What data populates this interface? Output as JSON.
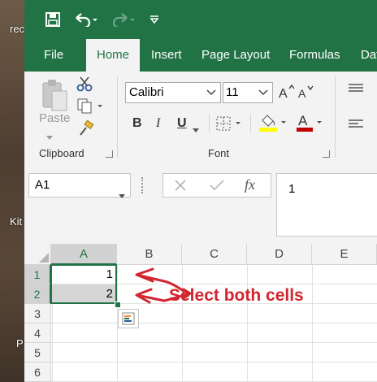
{
  "desktop": {
    "labels": [
      "rec",
      "Kit",
      "P"
    ]
  },
  "qat": {
    "save_icon": "save-icon",
    "undo_icon": "undo-icon",
    "redo_icon": "redo-icon",
    "customize_icon": "customize-qat-icon"
  },
  "tabs": [
    "File",
    "Home",
    "Insert",
    "Page Layout",
    "Formulas",
    "Dat"
  ],
  "active_tab": "Home",
  "clipboard": {
    "paste_label": "Paste",
    "group_label": "Clipboard"
  },
  "font": {
    "name": "Calibri",
    "size": "11",
    "bold": "B",
    "italic": "I",
    "underline": "U",
    "color_letter": "A",
    "group_label": "Font"
  },
  "formula_bar": {
    "name_box": "A1",
    "fx": "fx",
    "content": "1"
  },
  "grid": {
    "columns": [
      "A",
      "B",
      "C",
      "D",
      "E"
    ],
    "rows": [
      "1",
      "2",
      "3",
      "4",
      "5",
      "6"
    ],
    "cells": {
      "A1": "1",
      "A2": "2"
    }
  },
  "annotation": {
    "text": "Select both cells"
  },
  "colors": {
    "excel_green": "#217346",
    "annotation_red": "#d1262f",
    "font_color": "#c00000",
    "highlight": "#ffff00"
  }
}
